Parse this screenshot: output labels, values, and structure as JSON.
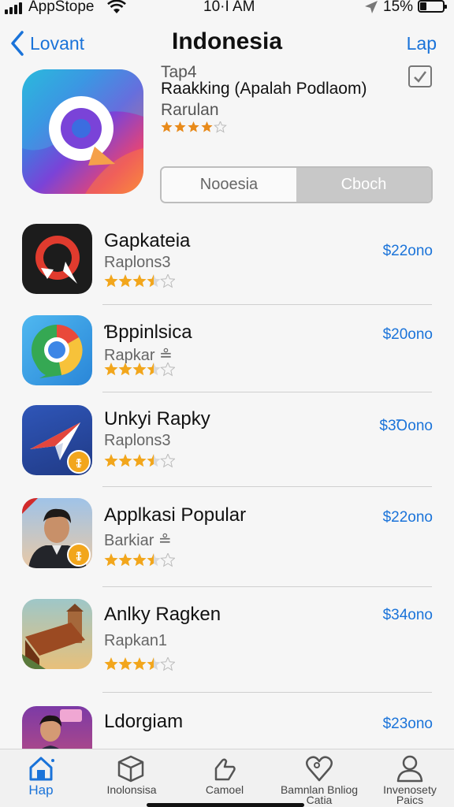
{
  "status_bar": {
    "carrier": "AppStope",
    "time": "10·I AM",
    "battery": "15%",
    "icons": [
      "signal-icon",
      "wifi-icon",
      "location-icon",
      "battery-icon"
    ]
  },
  "nav": {
    "back_label": "Lovant",
    "title": "Indonesia",
    "action_label": "Lap"
  },
  "featured": {
    "line1": "Tap4",
    "line2": "Raakking (Apalah Podlaom)",
    "line3": "Rarulan",
    "rating": 4,
    "segments": [
      "Nooesia",
      "Cboch"
    ],
    "selected_segment": 1
  },
  "apps": [
    {
      "name": "Gapkateia",
      "sub": "Raplons3",
      "price": "$22ono",
      "rating": 3.5
    },
    {
      "name": "Ɓppinlsica",
      "sub": "Rapkar ≗",
      "price": "$20ono",
      "rating": 3.5
    },
    {
      "name": "Unkyi Rapky",
      "sub": "Raplons3",
      "price": "$3Ꝺono",
      "rating": 3.5
    },
    {
      "name": "Applkasi Popular",
      "sub": "Barkiar ≗",
      "price": "$22ono",
      "rating": 3.5
    },
    {
      "name": "Anlky Ragken",
      "sub": "Rapkan1",
      "price": "$34ono",
      "rating": 3.5
    },
    {
      "name": "Ldorgiam",
      "sub": "",
      "price": "$23ono",
      "rating": 0
    }
  ],
  "tabs": [
    {
      "label": "Hap",
      "icon": "home-icon"
    },
    {
      "label": "Inolonsisa",
      "icon": "box-icon"
    },
    {
      "label": "Camoel",
      "icon": "hand-icon"
    },
    {
      "label": "Bamnlan Bnliog Catia",
      "icon": "heart-pin-icon"
    },
    {
      "label": "Invenosety Paics",
      "icon": "person-icon"
    }
  ],
  "colors": {
    "accent": "#1a73d9",
    "star": "#f2a61c"
  }
}
